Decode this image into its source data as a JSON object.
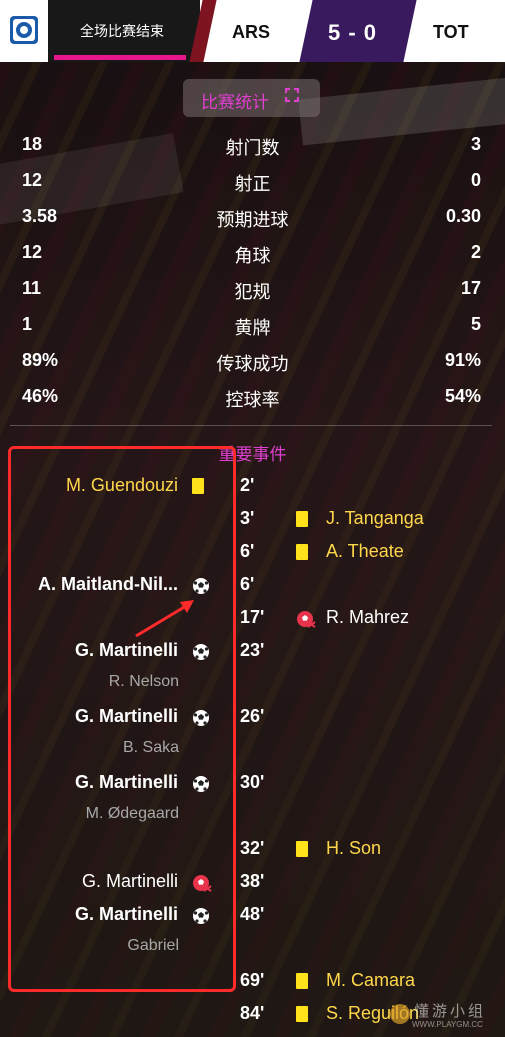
{
  "header": {
    "status": "全场比赛结束",
    "home_team": "ARS",
    "score": "5 - 0",
    "away_team": "TOT"
  },
  "stats": {
    "title": "比赛统计",
    "rows": [
      {
        "home": "18",
        "label": "射门数",
        "away": "3"
      },
      {
        "home": "12",
        "label": "射正",
        "away": "0"
      },
      {
        "home": "3.58",
        "label": "预期进球",
        "away": "0.30"
      },
      {
        "home": "12",
        "label": "角球",
        "away": "2"
      },
      {
        "home": "11",
        "label": "犯规",
        "away": "17"
      },
      {
        "home": "1",
        "label": "黄牌",
        "away": "5"
      },
      {
        "home": "89%",
        "label": "传球成功",
        "away": "91%"
      },
      {
        "home": "46%",
        "label": "控球率",
        "away": "54%"
      }
    ]
  },
  "events": {
    "title": "重要事件",
    "items": [
      {
        "minute": "2'",
        "side": "home",
        "type": "yellow-card",
        "player": "M. Guendouzi"
      },
      {
        "minute": "3'",
        "side": "away",
        "type": "yellow-card",
        "player": "J. Tanganga"
      },
      {
        "minute": "6'",
        "side": "away",
        "type": "yellow-card",
        "player": "A. Theate"
      },
      {
        "minute": "6'",
        "side": "home",
        "type": "goal",
        "player": "A. Maitland-Nil..."
      },
      {
        "minute": "17'",
        "side": "away",
        "type": "missed-penalty",
        "player": "R. Mahrez"
      },
      {
        "minute": "23'",
        "side": "home",
        "type": "goal",
        "player": "G. Martinelli",
        "assist": "R. Nelson"
      },
      {
        "minute": "26'",
        "side": "home",
        "type": "goal",
        "player": "G. Martinelli",
        "assist": "B. Saka"
      },
      {
        "minute": "30'",
        "side": "home",
        "type": "goal",
        "player": "G. Martinelli",
        "assist": "M. Ødegaard"
      },
      {
        "minute": "32'",
        "side": "away",
        "type": "yellow-card",
        "player": "H. Son"
      },
      {
        "minute": "38'",
        "side": "home",
        "type": "missed-penalty",
        "player": "G. Martinelli"
      },
      {
        "minute": "48'",
        "side": "home",
        "type": "goal",
        "player": "G. Martinelli",
        "assist": "Gabriel"
      },
      {
        "minute": "69'",
        "side": "away",
        "type": "yellow-card",
        "player": "M. Camara"
      },
      {
        "minute": "84'",
        "side": "away",
        "type": "yellow-card",
        "player": "S. Reguilón"
      }
    ]
  },
  "watermark": {
    "text": "懂游小组",
    "url": "WWW.PLAYGM.CC"
  },
  "colors": {
    "accent": "#e040d0",
    "card_yellow": "#ffe21a",
    "player_yellow": "#ffd84a",
    "score_bg": "#3a1a5e",
    "annotation_red": "#ff2a2a"
  }
}
